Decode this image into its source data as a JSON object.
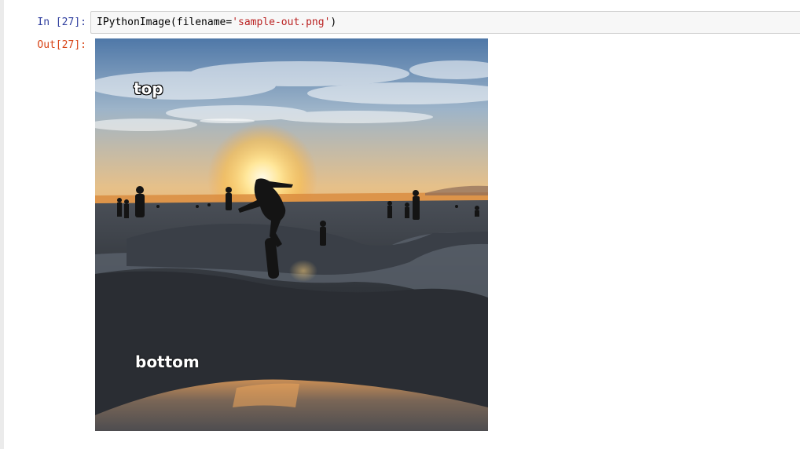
{
  "cell": {
    "in_prompt": "In [27]:",
    "out_prompt": "Out[27]:",
    "code": {
      "call": "IPythonImage(filename=",
      "string": "'sample-out.png'",
      "close": ")"
    }
  },
  "output": {
    "overlay_top": "top",
    "overlay_bottom": "bottom"
  },
  "colors": {
    "in_prompt": "#303f9f",
    "out_prompt": "#d84315",
    "string_literal": "#ba2121",
    "input_background": "#f7f7f7"
  }
}
